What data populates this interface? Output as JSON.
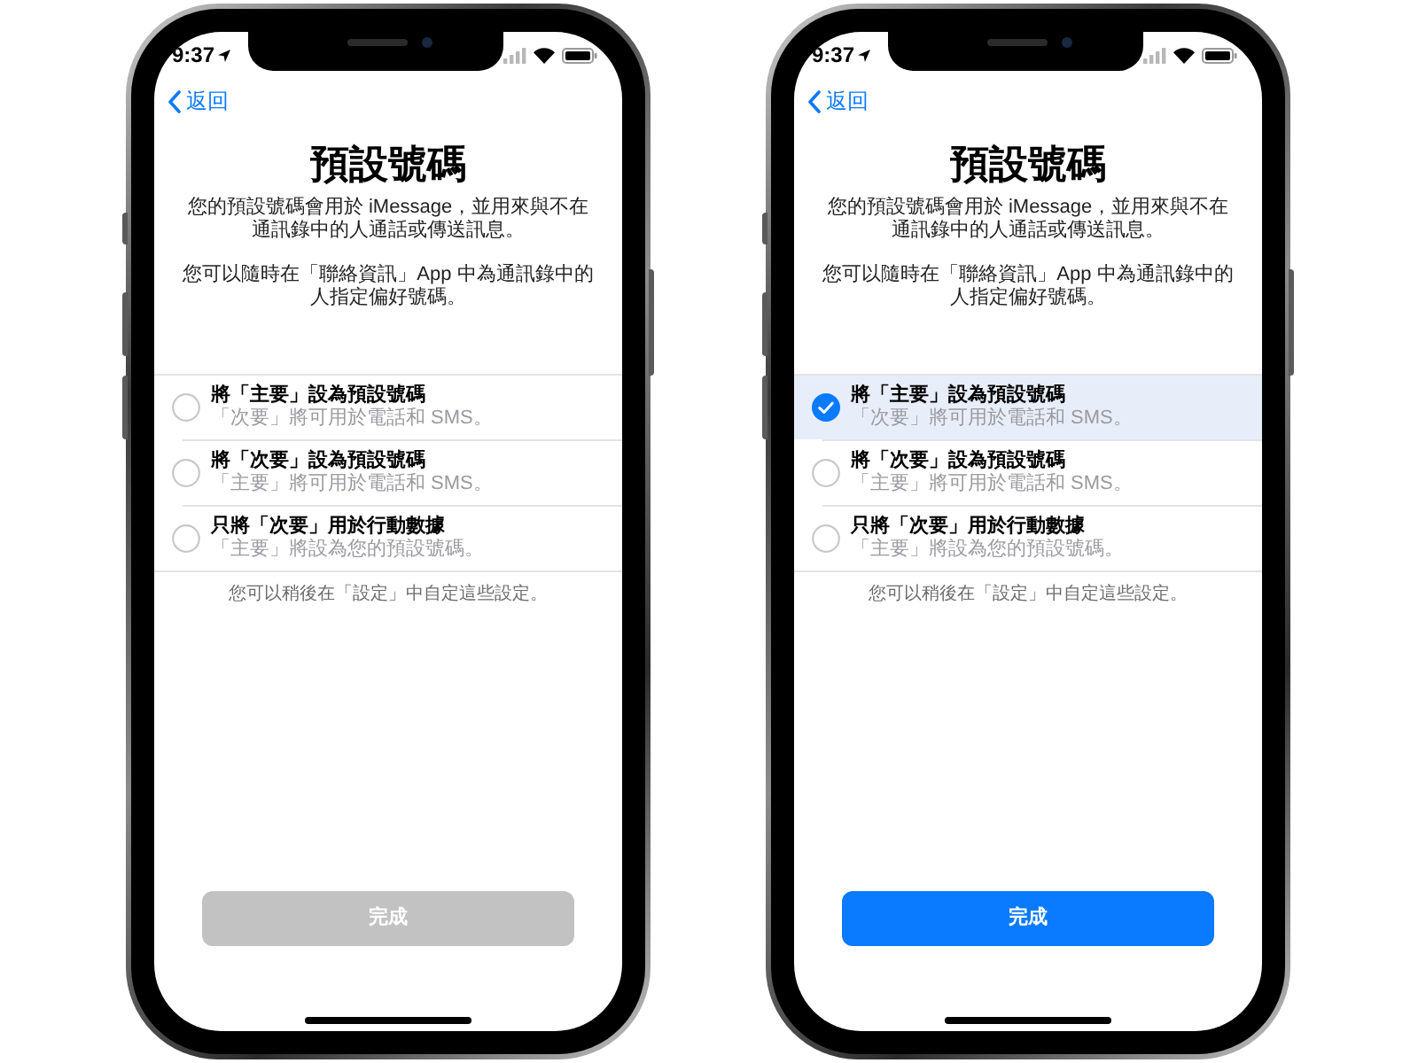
{
  "phones": [
    {
      "status_bar": {
        "time": "9:37"
      },
      "back_button": "返回",
      "title": "預設號碼",
      "description": [
        "您的預設號碼會用於 iMessage，並用來與不在通訊錄中的人通話或傳送訊息。",
        "您可以隨時在「聯絡資訊」App 中為通訊錄中的人指定偏好號碼。"
      ],
      "options": [
        {
          "title": "將「主要」設為預設號碼",
          "subtitle": "「次要」將可用於電話和 SMS。",
          "selected": false
        },
        {
          "title": "將「次要」設為預設號碼",
          "subtitle": "「主要」將可用於電話和 SMS。",
          "selected": false
        },
        {
          "title": "只將「次要」用於行動數據",
          "subtitle": "「主要」將設為您的預設號碼。",
          "selected": false
        }
      ],
      "footnote": "您可以稍後在「設定」中自定這些設定。",
      "done_button": {
        "label": "完成",
        "disabled": true
      }
    },
    {
      "status_bar": {
        "time": "9:37"
      },
      "back_button": "返回",
      "title": "預設號碼",
      "description": [
        "您的預設號碼會用於 iMessage，並用來與不在通訊錄中的人通話或傳送訊息。",
        "您可以隨時在「聯絡資訊」App 中為通訊錄中的人指定偏好號碼。"
      ],
      "options": [
        {
          "title": "將「主要」設為預設號碼",
          "subtitle": "「次要」將可用於電話和 SMS。",
          "selected": true
        },
        {
          "title": "將「次要」設為預設號碼",
          "subtitle": "「主要」將可用於電話和 SMS。",
          "selected": false
        },
        {
          "title": "只將「次要」用於行動數據",
          "subtitle": "「主要」將設為您的預設號碼。",
          "selected": false
        }
      ],
      "footnote": "您可以稍後在「設定」中自定這些設定。",
      "done_button": {
        "label": "完成",
        "disabled": false
      }
    }
  ]
}
